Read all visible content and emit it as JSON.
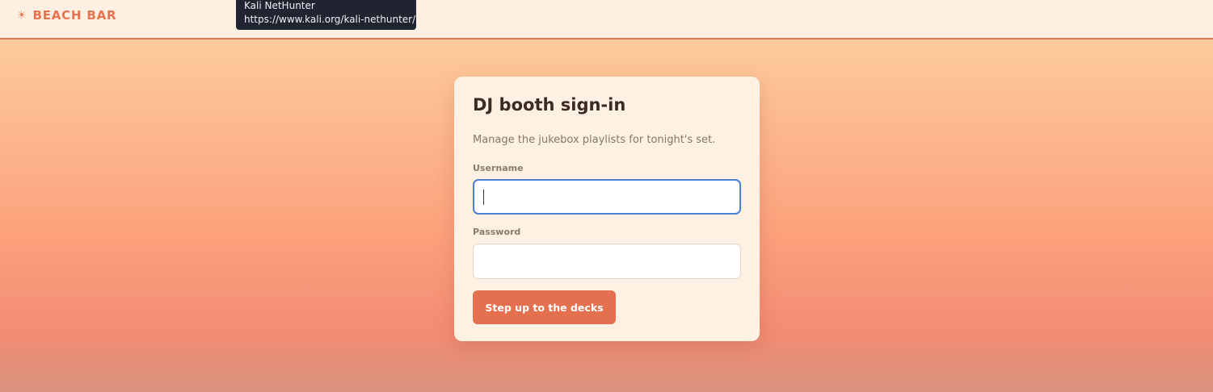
{
  "header": {
    "brand_icon": "sun-icon",
    "brand_icon_glyph": "☀",
    "brand_name": "BEACH BAR",
    "accent_color": "#e8734f"
  },
  "tooltip": {
    "title": "Kali NetHunter",
    "url": "https://www.kali.org/kali-nethunter/"
  },
  "login": {
    "title": "DJ booth sign-in",
    "subtitle": "Manage the jukebox playlists for tonight's set.",
    "username_label": "Username",
    "username_value": "",
    "password_label": "Password",
    "password_value": "",
    "submit_label": "Step up to the decks",
    "button_color": "#e4704f",
    "focus_color": "#4a7fd6"
  }
}
